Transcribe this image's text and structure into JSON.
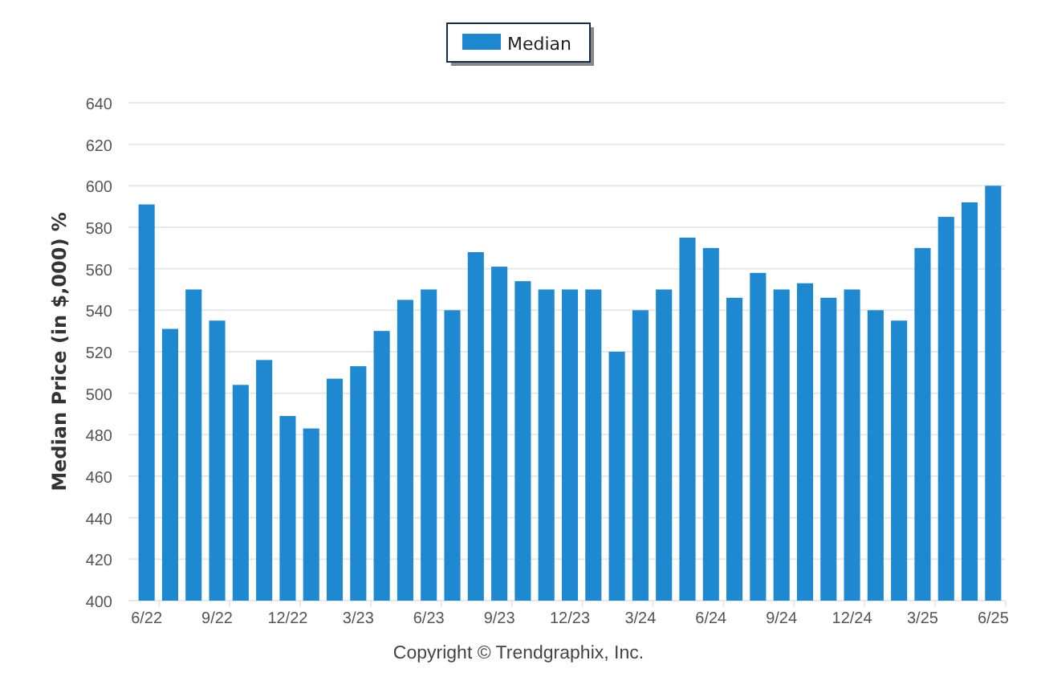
{
  "chart": {
    "chart_data": {
      "type": "bar",
      "ylabel": "Median Price (in $,000) %",
      "grid": true,
      "categories": [
        "6/22",
        null,
        null,
        "9/22",
        null,
        null,
        "12/22",
        null,
        null,
        "3/23",
        null,
        null,
        "6/23",
        null,
        null,
        "9/23",
        null,
        null,
        "12/23",
        null,
        null,
        "3/24",
        null,
        null,
        "6/24",
        null,
        null,
        "9/24",
        null,
        null,
        "12/24",
        null,
        null,
        "3/25",
        null,
        null,
        "6/25"
      ],
      "series": [
        {
          "name": "Median",
          "color": "#1e88d0",
          "values": [
            591,
            531,
            550,
            535,
            504,
            516,
            489,
            483,
            507,
            513,
            530,
            545,
            550,
            540,
            568,
            561,
            554,
            550,
            550,
            550,
            520,
            540,
            550,
            575,
            570,
            546,
            558,
            550,
            553,
            546,
            550,
            540,
            535,
            570,
            585,
            592,
            600
          ]
        }
      ],
      "ylim": [
        400,
        640
      ],
      "yticks": [
        400,
        420,
        440,
        460,
        480,
        500,
        520,
        540,
        560,
        580,
        600,
        620,
        640
      ]
    },
    "copyright": "Copyright © Trendgraphix, Inc."
  }
}
